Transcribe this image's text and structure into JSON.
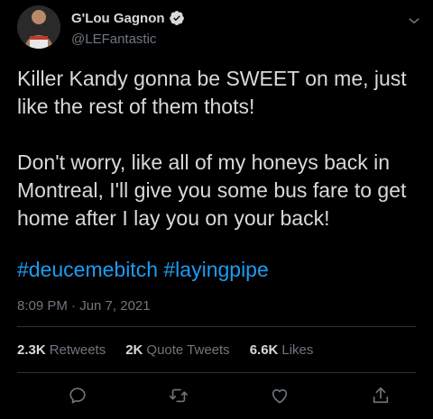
{
  "author": {
    "display_name": "G'Lou Gagnon",
    "handle": "@LEFantastic",
    "verified": true
  },
  "tweet": {
    "text": "Killer Kandy gonna be SWEET on me, just like the rest of them thots!\n\nDon't worry, like all of my honeys back in Montreal, I'll give you some bus fare to get home after I lay you on your back!",
    "hashtags": [
      "#deucemebitch",
      "#layingpipe"
    ],
    "timestamp": "8:09 PM · Jun 7, 2021"
  },
  "stats": {
    "retweets_count": "2.3K",
    "retweets_label": "Retweets",
    "quotes_count": "2K",
    "quotes_label": "Quote Tweets",
    "likes_count": "6.6K",
    "likes_label": "Likes"
  },
  "colors": {
    "background": "#000000",
    "text": "#d9d9d9",
    "secondary": "#6e767d",
    "link": "#1d9bf0",
    "divider": "#2f3336"
  },
  "icons": [
    "verified-badge-icon",
    "chevron-down-icon",
    "reply-icon",
    "retweet-icon",
    "like-icon",
    "share-icon"
  ]
}
